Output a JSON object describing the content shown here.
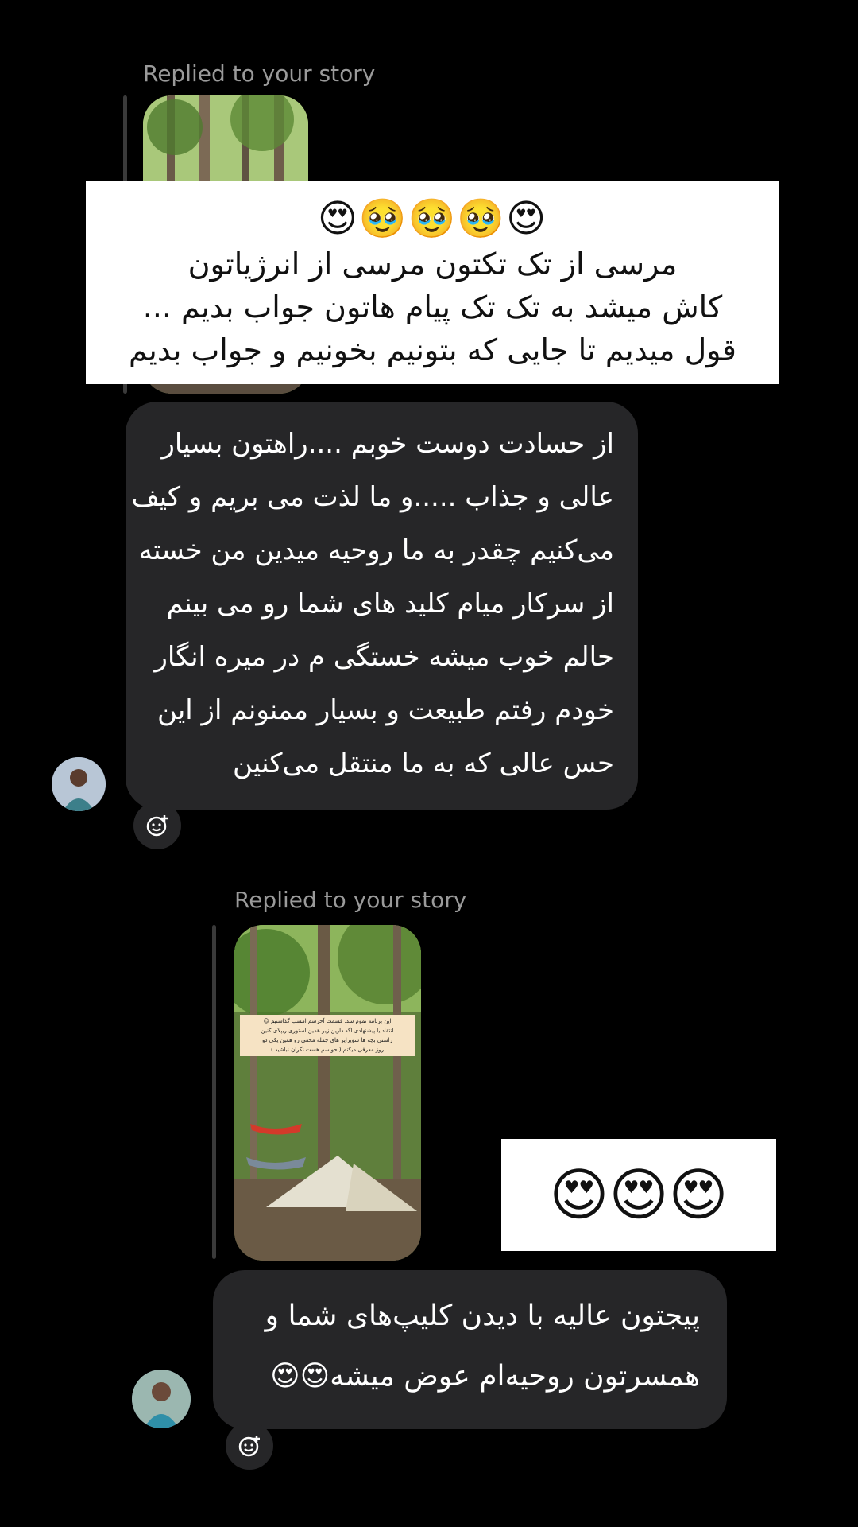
{
  "thread": [
    {
      "replied_label": "Replied to your story",
      "message_lines": [
        "از حسادت دوست خوبم ....راهتون بسیار",
        "عالی و جذاب .....و ما لذت می بریم و کیف",
        "می‌کنیم چقدر به ما روحیه میدین من خسته",
        "از سرکار میام کلید های شما رو می بینم",
        "حالم خوب میشه خستگی م در میره انگار",
        "خودم رفتم طبیعت و بسیار ممنونم از این",
        "حس عالی که به ما منتقل می‌کنین"
      ]
    },
    {
      "replied_label": "Replied to your story",
      "story_caption_lines": [
        "این برنامه تموم شد. قسمت آخرشم امشب گذاشتیم 😍",
        "انتقاد یا پیشنهادی اگه دارین زیر همین استوری ریپلای کنین",
        "راستی بچه ها سوپرایز های جمله مخفی رو همین یکی دو",
        "روز معرفی میکنم ( حواسم هست نگران نباشید )"
      ],
      "message_lines": [
        "پیجتون عالیه با دیدن کلیپ‌های شما و",
        "همسرتون روحیه‌ام عوض میشه😍😍"
      ]
    }
  ],
  "overlay_top": {
    "emojis": "😍🥹🥹🥹😍",
    "lines": [
      "مرسی از تک تکتون مرسی از انرژیاتون",
      "کاش میشد به تک تک پیام هاتون جواب بدیم ...",
      "قول میدیم تا جایی که بتونیم بخونیم و جواب بدیم"
    ]
  },
  "overlay_emoji_box": {
    "emojis": "😍😍😍"
  },
  "colors": {
    "background": "#000000",
    "bubble": "#262628",
    "muted": "#9a9a9a",
    "overlay": "#ffffff"
  }
}
